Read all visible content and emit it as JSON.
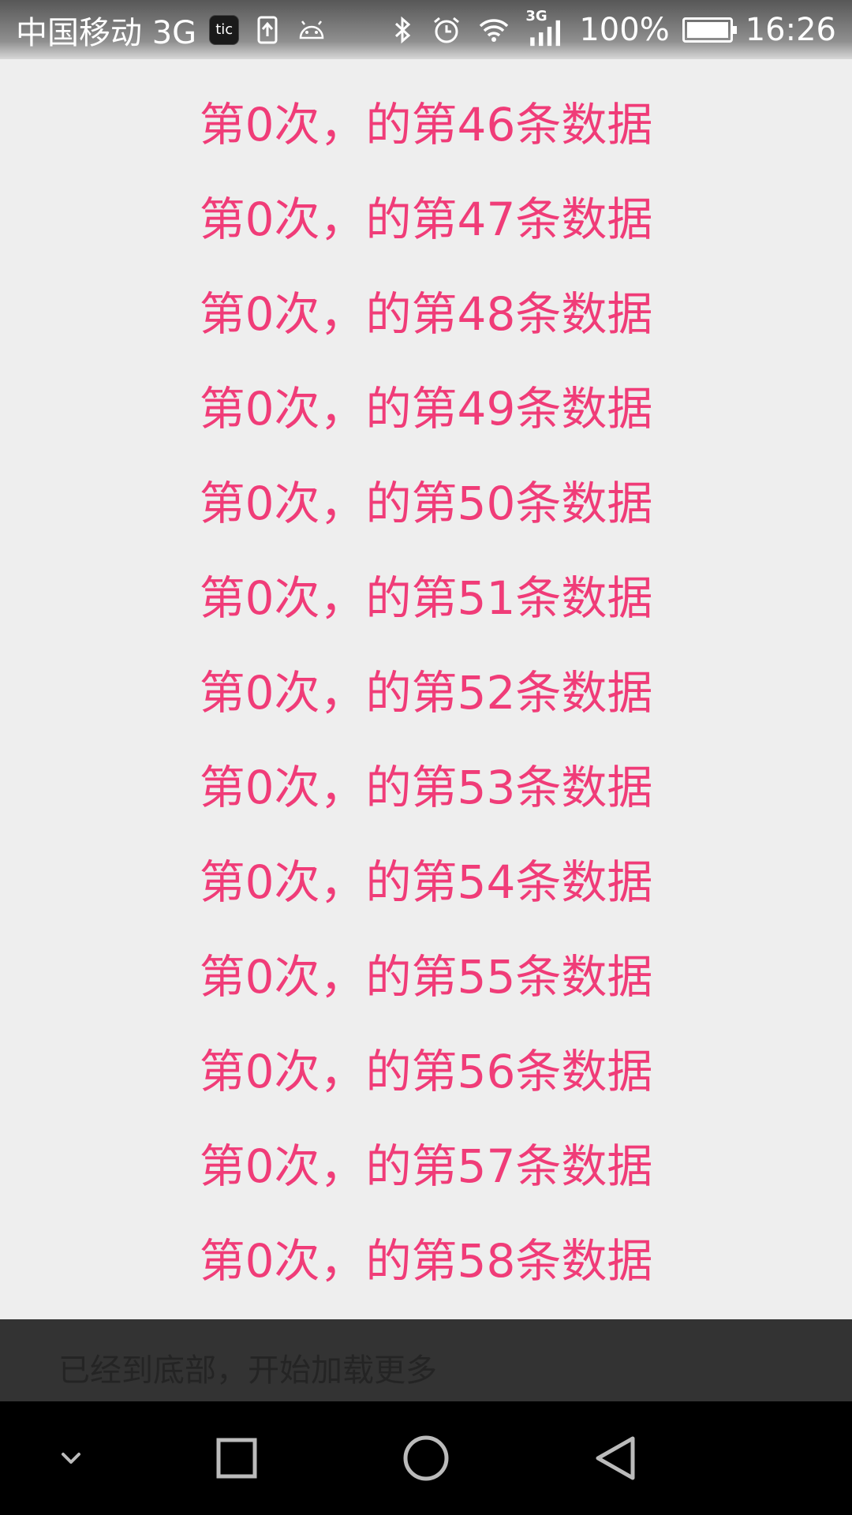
{
  "status_bar": {
    "carrier": "中国移动 3G",
    "tic_label": "tic",
    "network_type": "3G",
    "battery_percent": "100%",
    "battery_level": 1.0,
    "time": "16:26",
    "icons": [
      "tic-icon",
      "upload-icon",
      "android-icon",
      "bluetooth-icon",
      "alarm-icon",
      "wifi-icon",
      "signal-icon",
      "battery-icon"
    ]
  },
  "list": {
    "items": [
      "第0次，的第46条数据",
      "第0次，的第47条数据",
      "第0次，的第48条数据",
      "第0次，的第49条数据",
      "第0次，的第50条数据",
      "第0次，的第51条数据",
      "第0次，的第52条数据",
      "第0次，的第53条数据",
      "第0次，的第54条数据",
      "第0次，的第55条数据",
      "第0次，的第56条数据",
      "第0次，的第57条数据",
      "第0次，的第58条数据"
    ]
  },
  "footer": {
    "text": "已经到底部，开始加载更多"
  },
  "nav_bar": {
    "buttons": [
      "chevron-down-icon",
      "recent-apps-icon",
      "home-icon",
      "back-icon"
    ]
  },
  "colors": {
    "item_text": "#f03c78",
    "background": "#eeeeee",
    "footer_bg": "#333333",
    "nav_bg": "#000000"
  }
}
